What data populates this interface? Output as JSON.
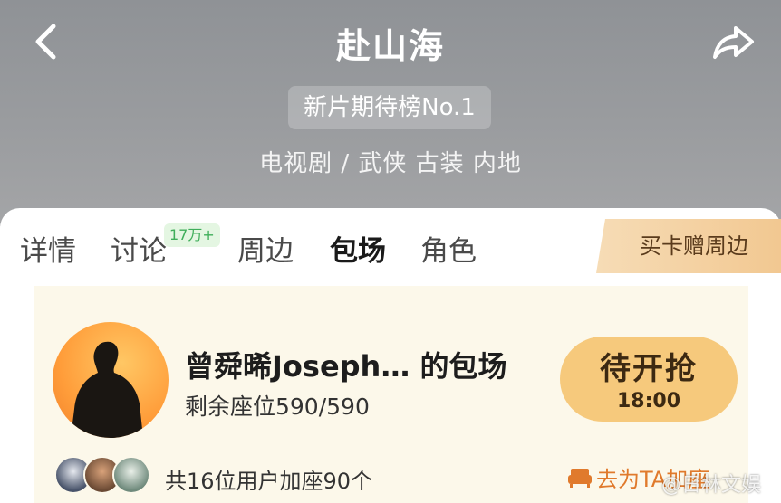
{
  "header": {
    "title": "赴山海",
    "rank_badge": "新片期待榜No.1",
    "genre": "电视剧 / 武侠 古装 内地"
  },
  "tabs": [
    {
      "label": "详情"
    },
    {
      "label": "讨论",
      "badge": "17万+"
    },
    {
      "label": "周边"
    },
    {
      "label": "包场",
      "active": true
    },
    {
      "label": "角色"
    }
  ],
  "promo": {
    "label": "买卡赠周边"
  },
  "booking_card": {
    "host_name": "曾舜晞Joseph…  的包场",
    "seats": "剩余座位590/590",
    "grab_button": {
      "label": "待开抢",
      "time": "18:00"
    },
    "joined_text": "共16位用户加座90个",
    "add_seat_link": "去为TA加座"
  },
  "watermark": "@日林文娱",
  "icons": {
    "back": "chevron-left-icon",
    "share": "share-arrow-icon",
    "sofa": "sofa-icon"
  },
  "colors": {
    "accent_orange": "#e07a2c",
    "grab_button": "#f6c97c",
    "badge_green": "#3fae5a"
  }
}
